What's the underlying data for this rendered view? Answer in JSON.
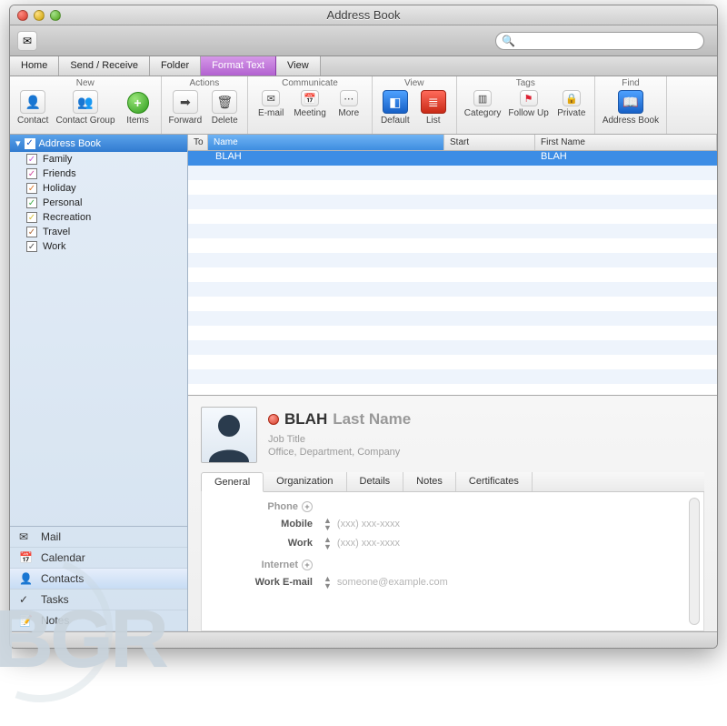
{
  "window": {
    "title": "Address Book"
  },
  "search": {
    "placeholder": ""
  },
  "tabs": [
    {
      "label": "Home"
    },
    {
      "label": "Send / Receive"
    },
    {
      "label": "Folder"
    },
    {
      "label": "Format Text"
    },
    {
      "label": "View"
    }
  ],
  "ribbon": {
    "new": {
      "title": "New",
      "items": [
        {
          "label": "Contact",
          "icon": "contact"
        },
        {
          "label": "Contact Group",
          "icon": "contact-group"
        },
        {
          "label": "Items",
          "icon": "plus"
        }
      ]
    },
    "actions": {
      "title": "Actions",
      "items": [
        {
          "label": "Forward",
          "icon": "forward"
        },
        {
          "label": "Delete",
          "icon": "delete"
        }
      ]
    },
    "communicate": {
      "title": "Communicate",
      "items": [
        {
          "label": "E-mail",
          "icon": "email"
        },
        {
          "label": "Meeting",
          "icon": "meeting"
        },
        {
          "label": "More",
          "icon": "more"
        }
      ]
    },
    "view": {
      "title": "View",
      "items": [
        {
          "label": "Default",
          "icon": "default"
        },
        {
          "label": "List",
          "icon": "list"
        }
      ]
    },
    "tags": {
      "title": "Tags",
      "items": [
        {
          "label": "Category",
          "icon": "category"
        },
        {
          "label": "Follow Up",
          "icon": "flag"
        },
        {
          "label": "Private",
          "icon": "lock"
        }
      ]
    },
    "find": {
      "title": "Find",
      "items": [
        {
          "label": "Address Book",
          "icon": "addressbook"
        }
      ]
    }
  },
  "sidebar": {
    "header": "Address Book",
    "groups": [
      {
        "label": "Family",
        "color": "#c55bd4"
      },
      {
        "label": "Friends",
        "color": "#d14aa0"
      },
      {
        "label": "Holiday",
        "color": "#e07a2e"
      },
      {
        "label": "Personal",
        "color": "#3fae4a"
      },
      {
        "label": "Recreation",
        "color": "#d8c13a"
      },
      {
        "label": "Travel",
        "color": "#b06b3a"
      },
      {
        "label": "Work",
        "color": "#555555"
      }
    ]
  },
  "nav": {
    "items": [
      {
        "label": "Mail",
        "icon": "mail"
      },
      {
        "label": "Calendar",
        "icon": "calendar"
      },
      {
        "label": "Contacts",
        "icon": "contacts"
      },
      {
        "label": "Tasks",
        "icon": "tasks"
      },
      {
        "label": "Notes",
        "icon": "notes"
      }
    ],
    "selected": "Contacts"
  },
  "list": {
    "columns": {
      "to": "To",
      "name": "Name",
      "start": "Start",
      "first": "First Name"
    },
    "rows": [
      {
        "name": "BLAH",
        "first": "BLAH"
      }
    ]
  },
  "detail": {
    "first_name": "BLAH",
    "last_name": "Last Name",
    "job_title": "Job Title",
    "org_line": "Office, Department, Company",
    "tabs": [
      "General",
      "Organization",
      "Details",
      "Notes",
      "Certificates"
    ],
    "sections": {
      "phone_label": "Phone",
      "mobile_label": "Mobile",
      "mobile_value": "(xxx) xxx-xxxx",
      "work_label": "Work",
      "work_value": "(xxx) xxx-xxxx",
      "internet_label": "Internet",
      "work_email_label": "Work E-mail",
      "work_email_value": "someone@example.com"
    }
  },
  "watermark": "BGR"
}
